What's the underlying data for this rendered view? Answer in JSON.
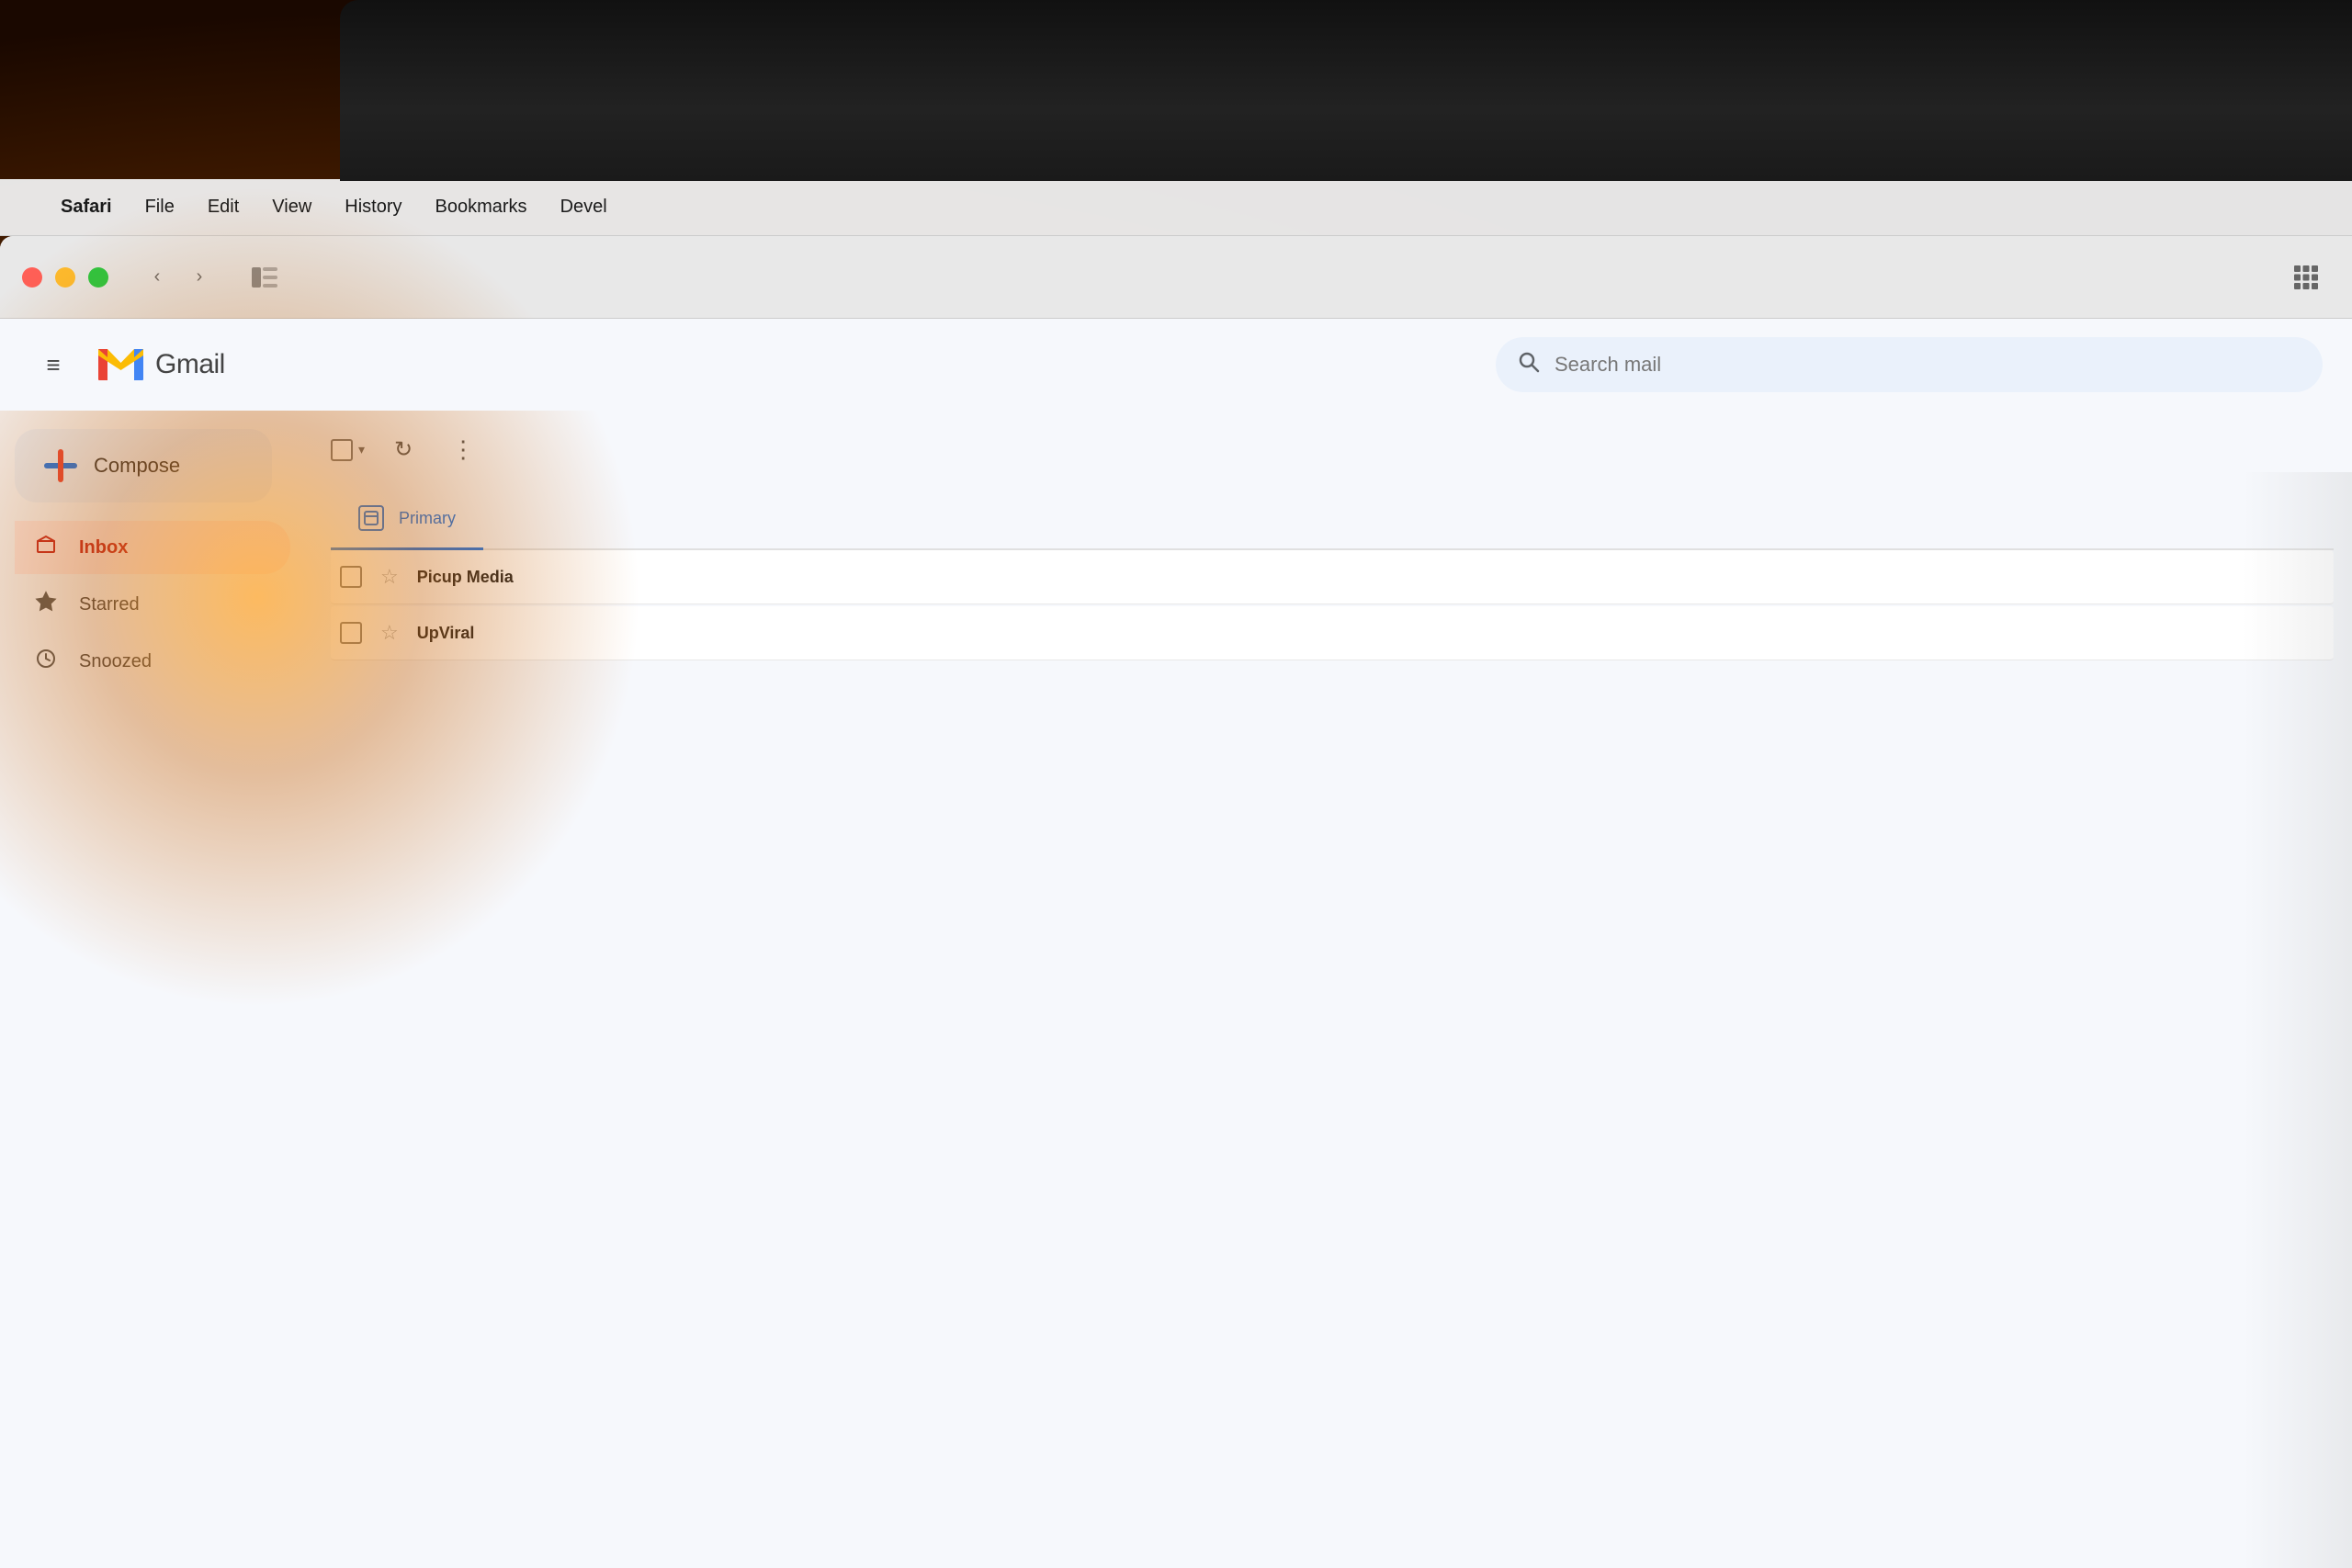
{
  "background": {
    "color": "#1a0800"
  },
  "menubar": {
    "apple_symbol": "",
    "items": [
      "Safari",
      "File",
      "Edit",
      "View",
      "History",
      "Bookmarks",
      "Devel"
    ]
  },
  "browser_toolbar": {
    "back_label": "‹",
    "forward_label": "›",
    "sidebar_icon": "⬜",
    "grid_icon": "⠿"
  },
  "gmail_header": {
    "hamburger_icon": "≡",
    "logo_text": "Gmail",
    "search_placeholder": "Search mail"
  },
  "sidebar": {
    "compose_label": "Compose",
    "nav_items": [
      {
        "id": "inbox",
        "label": "Inbox",
        "icon": "inbox",
        "active": true
      },
      {
        "id": "starred",
        "label": "Starred",
        "icon": "star",
        "active": false
      },
      {
        "id": "snoozed",
        "label": "Snoozed",
        "icon": "clock",
        "active": false
      }
    ]
  },
  "email_main": {
    "toolbar": {
      "refresh_icon": "↻",
      "more_icon": "⋮"
    },
    "tabs": [
      {
        "id": "primary",
        "label": "Primary",
        "active": true
      }
    ],
    "emails": [
      {
        "sender": "Picup Media",
        "star": false
      },
      {
        "sender": "UpViral",
        "star": false
      }
    ]
  }
}
